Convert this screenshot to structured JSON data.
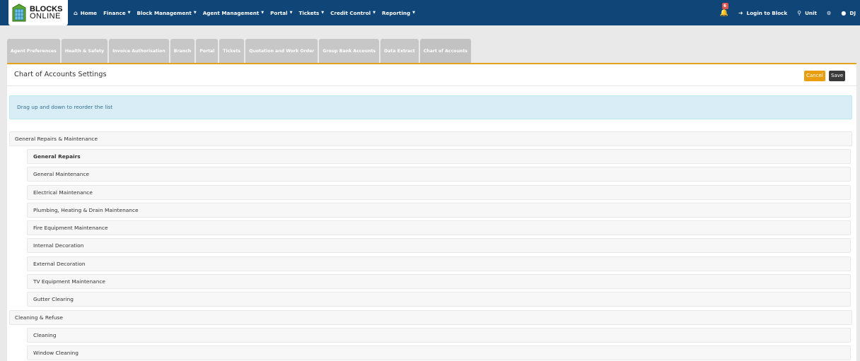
{
  "brand": {
    "line1": "BLOCKS",
    "line2": "ONLINE"
  },
  "nav": {
    "items": [
      {
        "label": "Home",
        "icon": "home-icon",
        "caret": false
      },
      {
        "label": "Finance",
        "caret": true
      },
      {
        "label": "Block Management",
        "caret": true
      },
      {
        "label": "Agent Management",
        "caret": true
      },
      {
        "label": "Portal",
        "caret": true
      },
      {
        "label": "Tickets",
        "caret": true
      },
      {
        "label": "Credit Control",
        "caret": true
      },
      {
        "label": "Reporting",
        "caret": true
      }
    ],
    "notification_count": "6",
    "login_to_block": "Login to Block",
    "unit": "Unit",
    "user": "DJ"
  },
  "tabs": [
    "Agent Preferences",
    "Health & Safety",
    "Invoice Authorisation",
    "Branch",
    "Portal",
    "Tickets",
    "Quotation and Work Order",
    "Group Bank Accounts",
    "Data Extract",
    "Chart of Accounts"
  ],
  "active_tab_index": 9,
  "panel": {
    "title": "Chart of Accounts Settings",
    "cancel_label": "Cancel",
    "save_label": "Save",
    "alert": "Drag up and down to reorder the list"
  },
  "groups": [
    {
      "name": "General Repairs & Maintenance",
      "items": [
        "General Repairs",
        "General Maintenance",
        "Electrical Maintenance",
        "Plumbing, Heating & Drain Maintenance",
        "Fire Equipment Maintenance",
        "Internal Decoration",
        "External Decoration",
        "TV Equipment Maintenance",
        "Gutter Clearing"
      ]
    },
    {
      "name": "Cleaning & Refuse",
      "items": [
        "Cleaning",
        "Window Cleaning"
      ]
    }
  ],
  "colors": {
    "navbar": "#0f4577",
    "accent": "#e5a21b",
    "cancel": "#e99e0f",
    "save": "#3a3a3a",
    "alert_bg": "#d9edf7"
  }
}
